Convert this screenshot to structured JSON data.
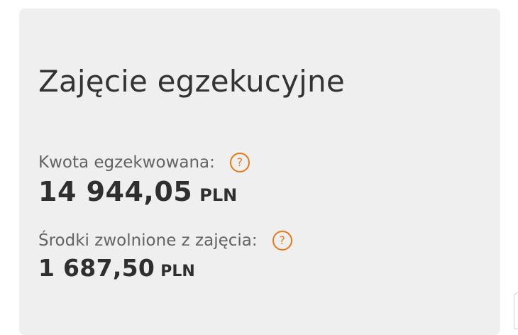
{
  "panel": {
    "title": "Zajęcie egzekucyjne",
    "enforced": {
      "label": "Kwota egzekwowana:",
      "amount": "14 944,05",
      "currency": "PLN",
      "help_icon": "question-circle-icon"
    },
    "released": {
      "label": "Środki zwolnione z zajęcia:",
      "amount": "1 687,50",
      "currency": "PLN",
      "help_icon": "question-circle-icon"
    }
  },
  "colors": {
    "accent": "#e77b1a",
    "card_background": "#efefef",
    "text_primary": "#2f2f2f",
    "text_secondary": "#636363"
  }
}
